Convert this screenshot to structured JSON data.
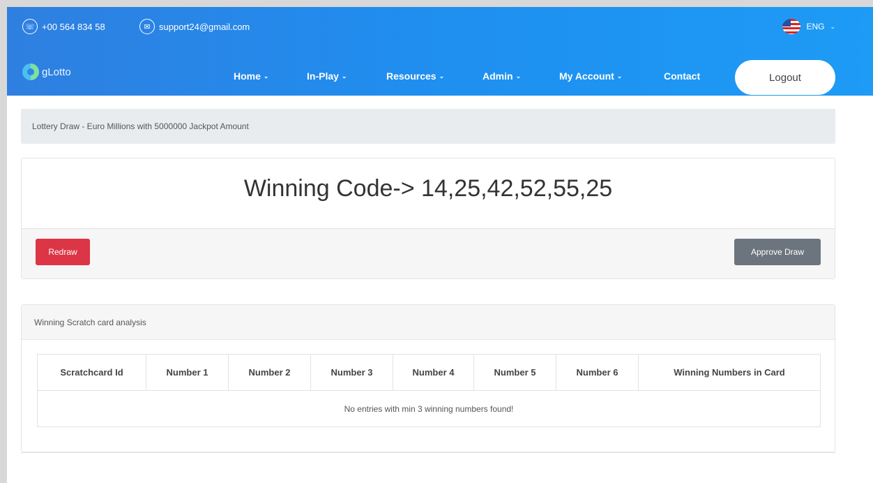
{
  "topbar": {
    "phone": "+00 564 834 58",
    "email": "support24@gmail.com",
    "language": "ENG"
  },
  "navbar": {
    "logo_text": "gLotto",
    "items": [
      {
        "label": "Home",
        "has_dropdown": true
      },
      {
        "label": "In-Play",
        "has_dropdown": true
      },
      {
        "label": "Resources",
        "has_dropdown": true
      },
      {
        "label": "Admin",
        "has_dropdown": true
      },
      {
        "label": "My Account",
        "has_dropdown": true
      },
      {
        "label": "Contact",
        "has_dropdown": false
      }
    ],
    "logout_label": "Logout",
    "chevron": "⌄"
  },
  "breadcrumb": {
    "text": "Lottery Draw - Euro Millions with 5000000 Jackpot Amount"
  },
  "draw": {
    "winning_code": "Winning Code-> 14,25,42,52,55,25",
    "redraw_label": "Redraw",
    "approve_label": "Approve Draw"
  },
  "analysis": {
    "title": "Winning Scratch card analysis",
    "columns": [
      "Scratchcard Id",
      "Number 1",
      "Number 2",
      "Number 3",
      "Number 4",
      "Number 5",
      "Number 6",
      "Winning Numbers in Card"
    ],
    "empty_message": "No entries with min 3 winning numbers found!"
  },
  "colors": {
    "header_start": "#2f7fe0",
    "header_end": "#1d9bf5",
    "redraw": "#dc3545",
    "approve": "#6c757d"
  }
}
